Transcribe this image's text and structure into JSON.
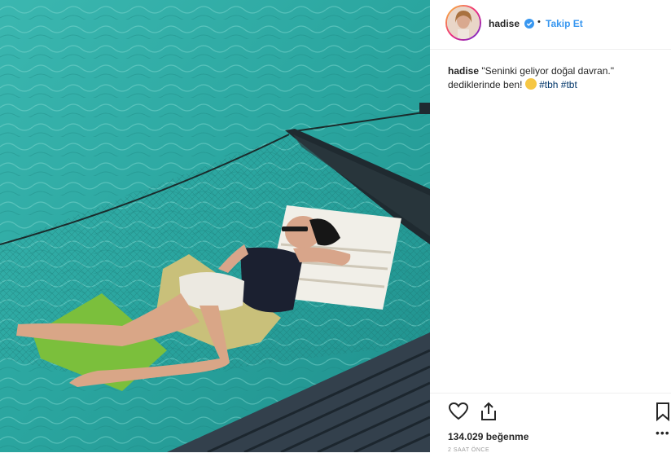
{
  "post": {
    "username": "hadise",
    "follow_label": "Takip Et",
    "separator": "•",
    "caption_user": "hadise",
    "caption_text": " \"Seninki geliyor doğal davran.\" dediklerinde ben!",
    "hashtags": [
      "#tbh",
      "#tbt"
    ],
    "likes": "134.029 beğenme",
    "time_ago": "2 SAAT ÖNCE",
    "more": "•••"
  },
  "colors": {
    "link": "#3897f0",
    "hashtag": "#003569",
    "text": "#262626",
    "water": "#2fa9a6",
    "deck": "#3b4a5a"
  },
  "icons": [
    "verified-badge-icon",
    "heart-icon",
    "share-icon",
    "bookmark-icon",
    "more-icon"
  ]
}
